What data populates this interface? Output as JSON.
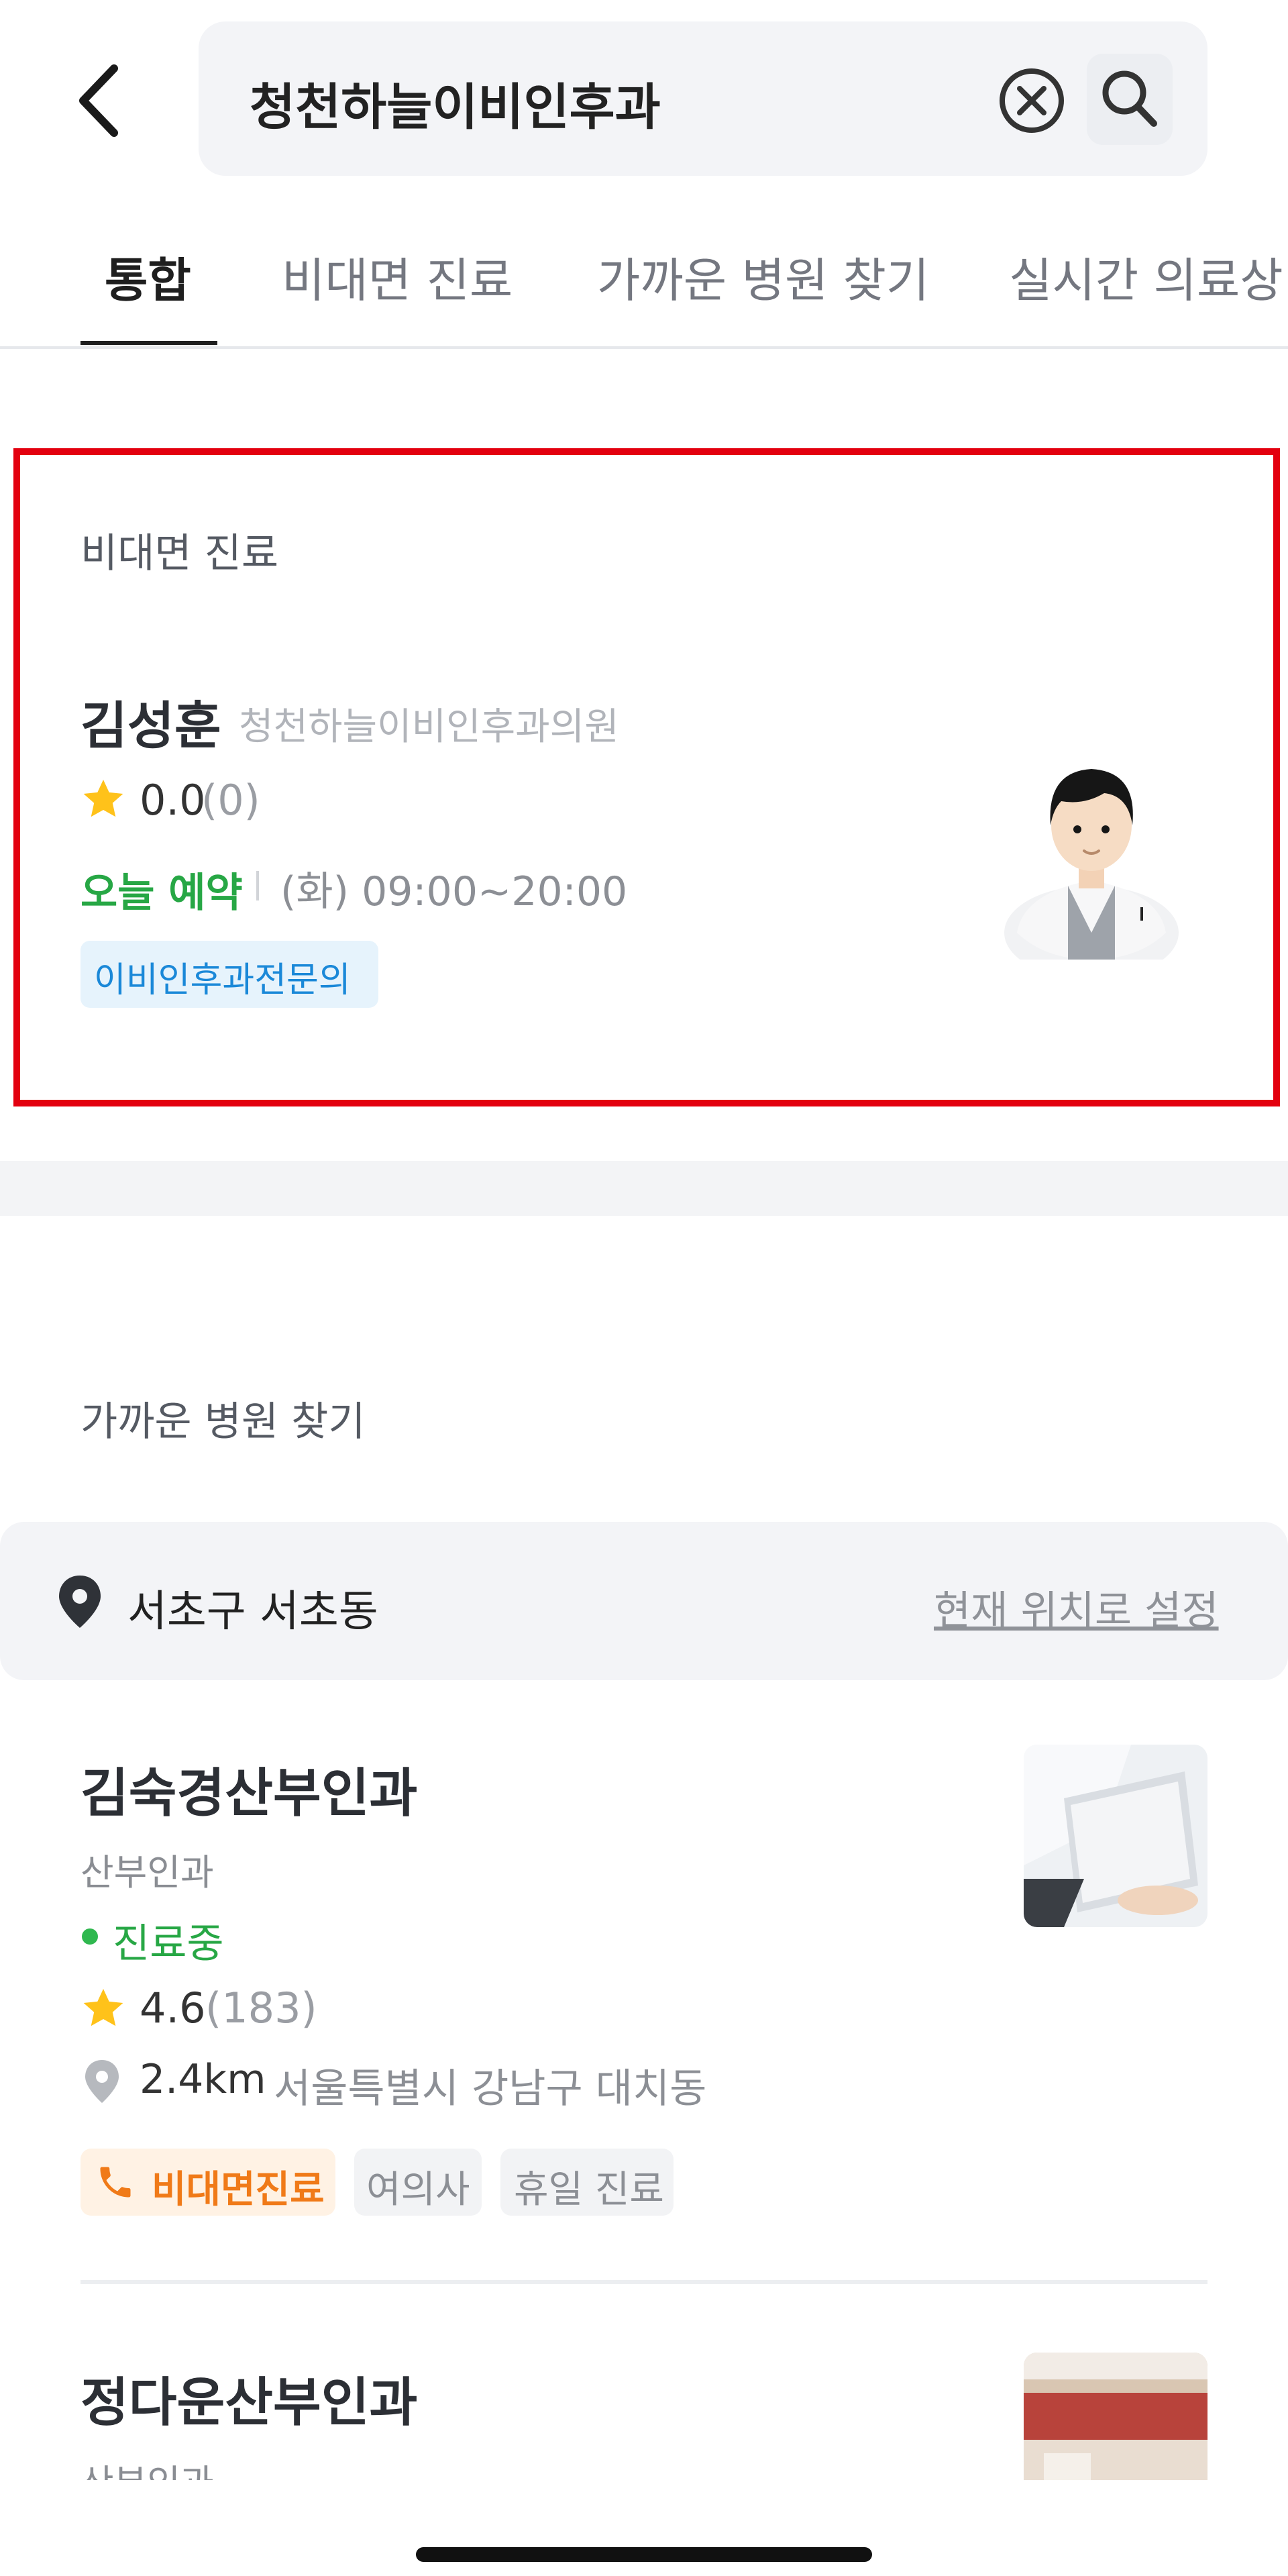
{
  "header": {
    "back_icon": "chevron-left-icon",
    "search_query": "청천하늘이비인후과",
    "clear_icon": "clear-circle-icon",
    "search_icon": "search-icon"
  },
  "tabs": [
    {
      "label": "통합",
      "active": true
    },
    {
      "label": "비대면 진료",
      "active": false
    },
    {
      "label": "가까운 병원 찾기",
      "active": false
    },
    {
      "label": "실시간 의료상",
      "active": false
    }
  ],
  "telemedicine": {
    "section_title": "비대면 진료",
    "doctor_name": "김성훈",
    "clinic_name": "청천하늘이비인후과의원",
    "rating": "0.0",
    "rating_count": "(0)",
    "reserve_label": "오늘 예약",
    "hours": "(화) 09:00~20:00",
    "specialty_tag": "이비인후과전문의"
  },
  "nearby": {
    "section_title": "가까운 병원 찾기",
    "location": "서초구 서초동",
    "set_location_link": "현재 위치로 설정",
    "hospitals": [
      {
        "name": "김숙경산부인과",
        "dept": "산부인과",
        "status": "진료중",
        "rating": "4.6",
        "rating_count": "(183)",
        "distance": "2.4km",
        "address": "서울특별시 강남구 대치동",
        "tags": [
          "비대면진료",
          "여의사",
          "휴일 진료"
        ]
      },
      {
        "name": "정다운산부인과",
        "dept": "산부인과"
      }
    ]
  },
  "colors": {
    "accent_green": "#27a745",
    "highlight_red": "#e3000f",
    "tag_blue": "#1a88d8",
    "tag_orange": "#f07a18"
  }
}
